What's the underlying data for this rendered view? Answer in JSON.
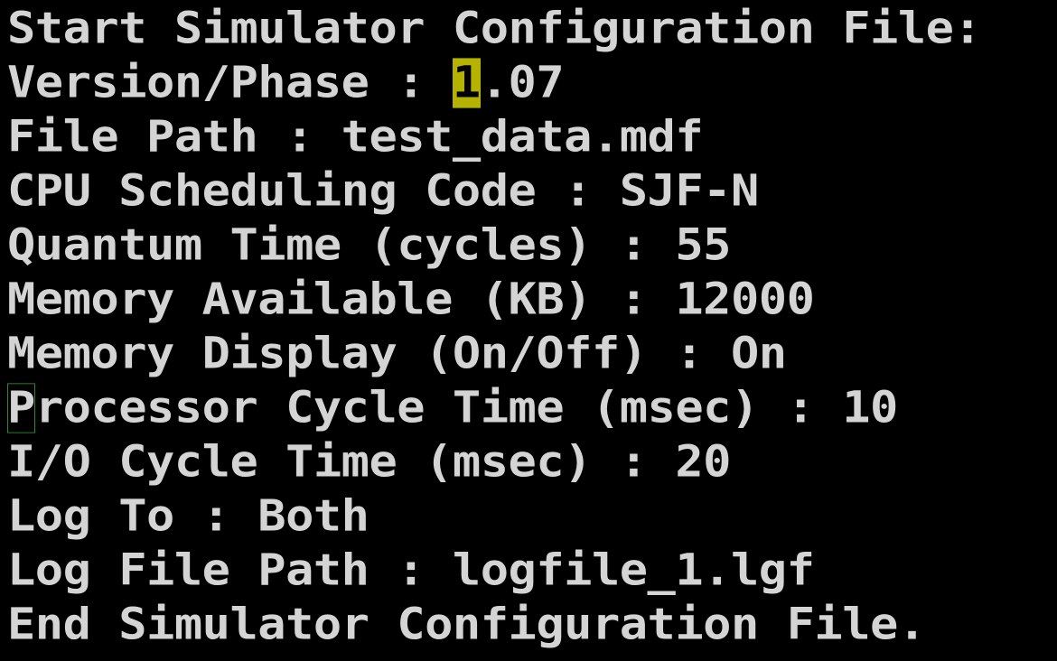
{
  "terminal": {
    "colors": {
      "background": "#000000",
      "foreground": "#d4d4d4",
      "cursor_highlight": "#b5b300",
      "cursor_outline": "#2a8a2a"
    },
    "lines": {
      "l1": "Start Simulator Configuration File:",
      "l2_before": "Version/Phase : ",
      "l2_cursor": "1",
      "l2_after": ".07",
      "l3": "File Path : test_data.mdf",
      "l4": "CPU Scheduling Code : SJF-N",
      "l5": "Quantum Time (cycles) : 55",
      "l6": "Memory Available (KB) : 12000",
      "l7": "Memory Display (On/Off) : On",
      "l8_first": "P",
      "l8_rest": "rocessor Cycle Time (msec) : 10",
      "l9": "I/O Cycle Time (msec) : 20",
      "l10": "Log To : Both",
      "l11": "Log File Path : logfile_1.lgf",
      "l12": "End Simulator Configuration File."
    }
  }
}
